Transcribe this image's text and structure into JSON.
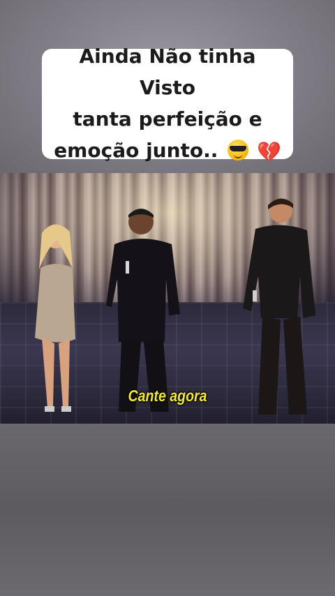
{
  "caption": {
    "line1": "Ainda Não tinha Visto",
    "line2": "tanta perfeição e",
    "line3": "emoção junto..",
    "emoji1": "sunglasses-face-emoji",
    "emoji2": "💔"
  },
  "video": {
    "subtitle": "Cante agora"
  },
  "colors": {
    "caption_bg": "#ffffff",
    "caption_text": "#1b1b1b",
    "subtitle": "#f2ea2a"
  }
}
